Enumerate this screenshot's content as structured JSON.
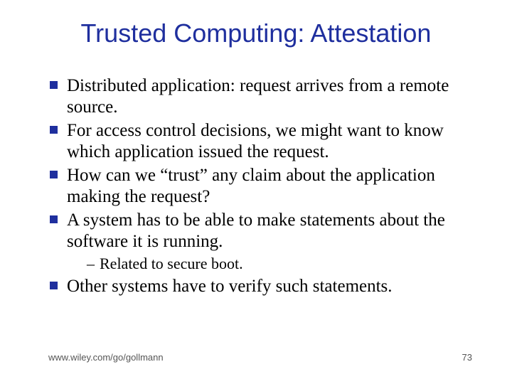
{
  "title": "Trusted Computing: Attestation",
  "bullets": [
    {
      "text": "Distributed application: request arrives from a remote source."
    },
    {
      "text": "For access control decisions, we might want to know which application issued the request."
    },
    {
      "text": "How can we “trust” any claim about the application making the request?"
    },
    {
      "text": "A system has to be able to make statements about the software it is running.",
      "sub": [
        "Related to secure boot."
      ]
    },
    {
      "text": "Other systems have to verify such statements."
    }
  ],
  "footer": {
    "url": "www.wiley.com/go/gollmann",
    "page": "73"
  }
}
